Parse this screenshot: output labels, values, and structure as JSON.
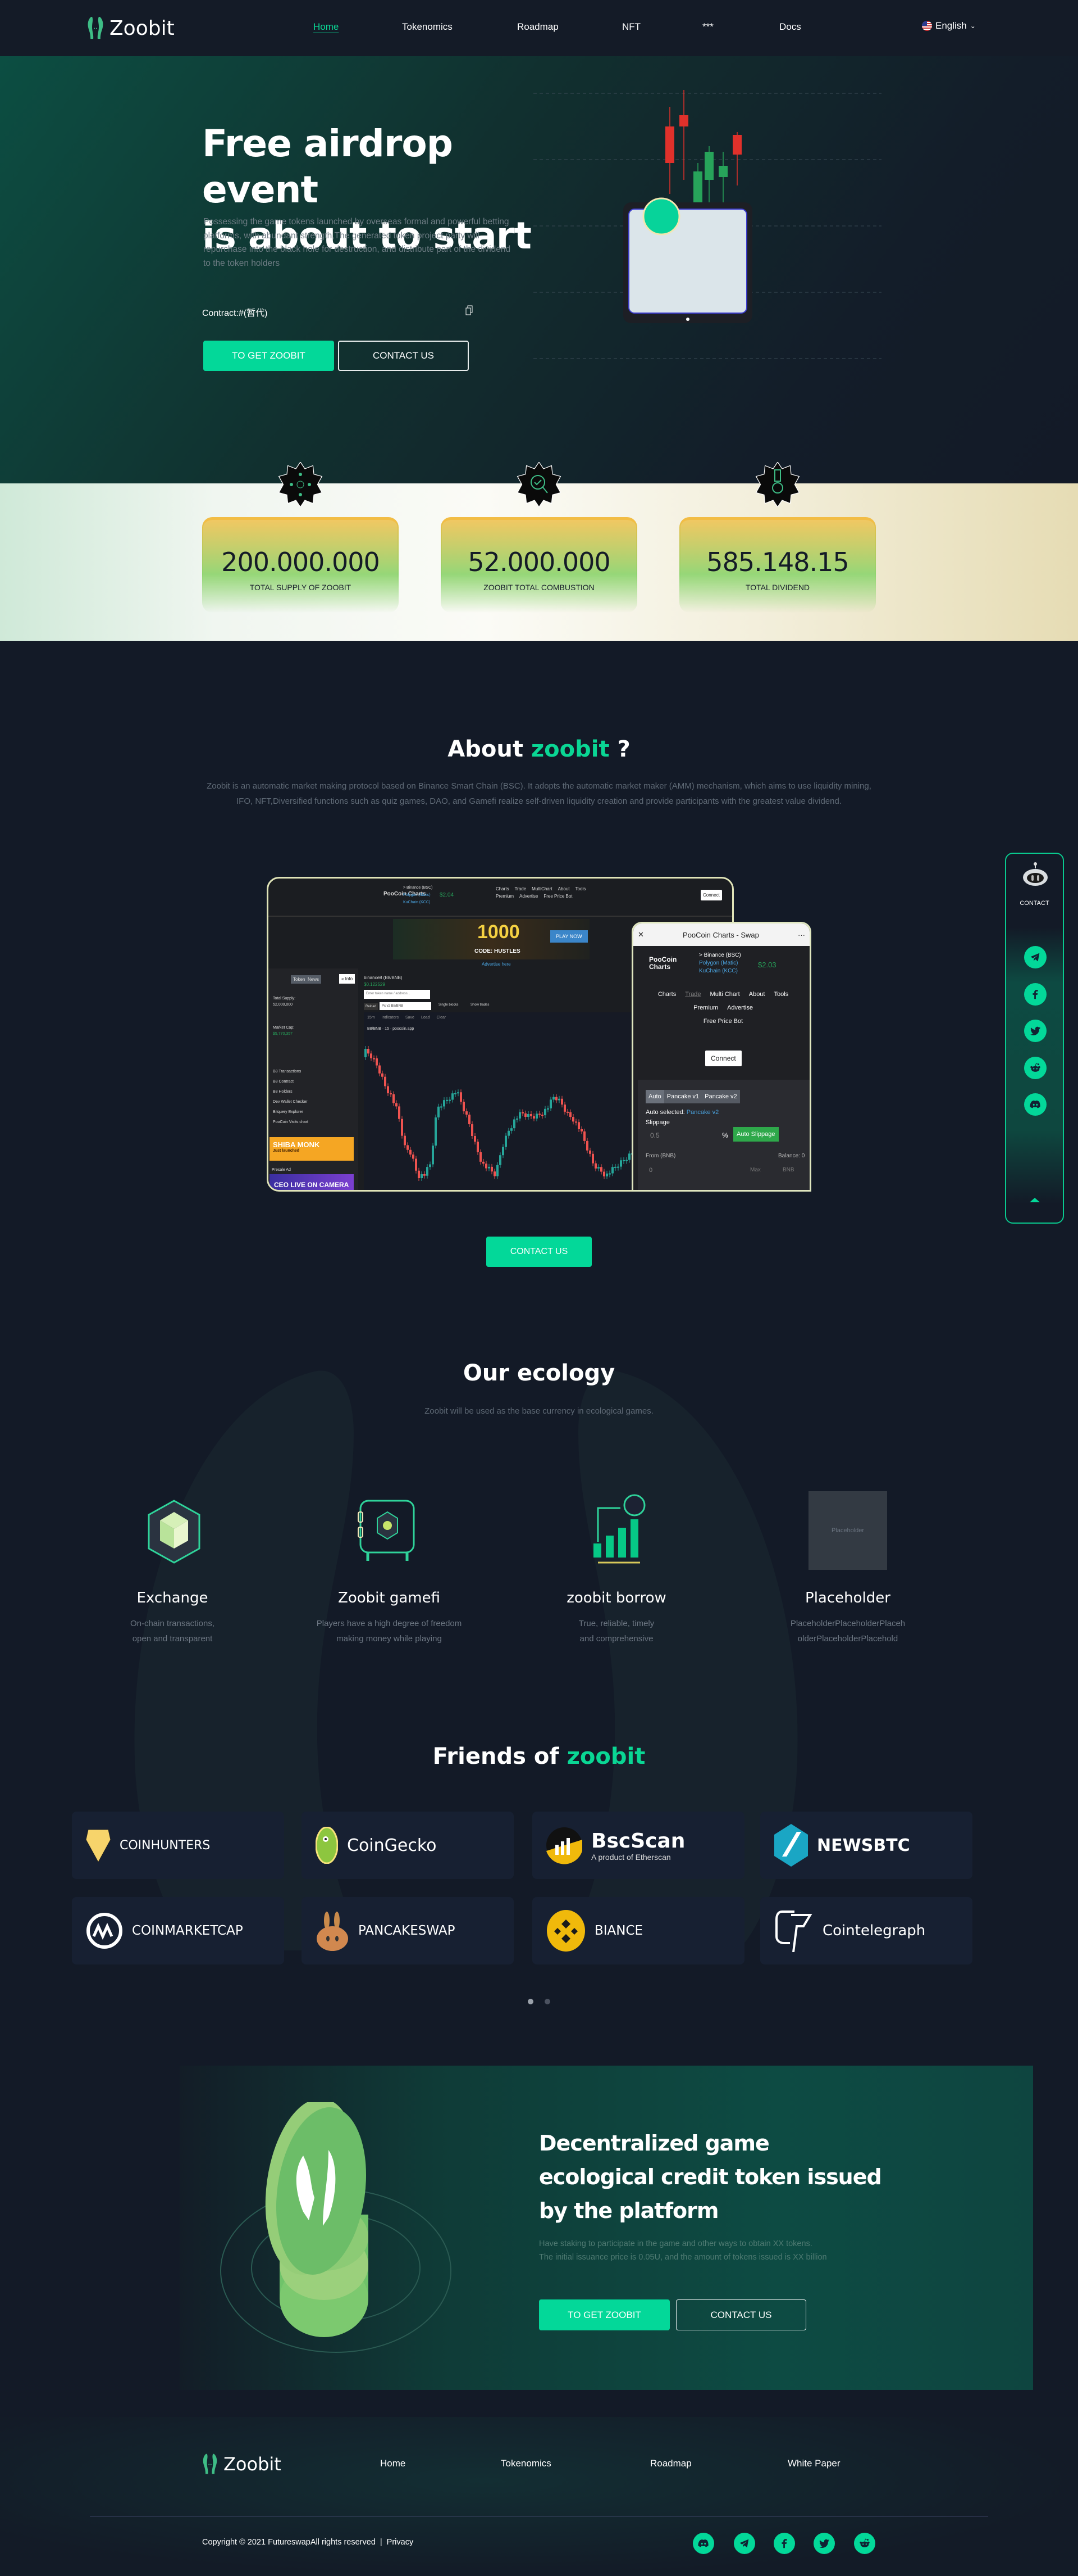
{
  "colors": {
    "accent": "#03d899",
    "bg": "#131a27",
    "card_border": "#f2bd45",
    "candle_up": "#27a35a",
    "candle_down": "#e0312b"
  },
  "nav": {
    "brand": "Zoobit",
    "items": [
      {
        "label": "Home",
        "active": true
      },
      {
        "label": "Tokenomics"
      },
      {
        "label": "Roadmap"
      },
      {
        "label": "NFT"
      },
      {
        "label": "***"
      },
      {
        "label": "Docs"
      }
    ],
    "language": "English",
    "language_icon": "us-flag-icon"
  },
  "hero": {
    "title_line1": "Free airdrop event",
    "title_line2": "is about to start",
    "description": "Possessing the game tokens launched by overseas formal and powerful betting platforms, with abundant strength,The generated token project party will repurchase into the black hole for destruction, and distribute part of the dividend to the token holders",
    "contract": "Contract:#(暂代)",
    "primary_button": "TO GET ZOOBIT",
    "secondary_button": "CONTACT US"
  },
  "stats": [
    {
      "value": "200.000.000",
      "label": "TOTAL SUPPLY OF ZOOBIT",
      "icon": "network-icon"
    },
    {
      "value": "52.000.000",
      "label": "ZOOBIT TOTAL COMBUSTION",
      "icon": "magnifier-check-icon"
    },
    {
      "value": "585.148.15",
      "label": "TOTAL DIVIDEND",
      "icon": "medal-icon"
    }
  ],
  "about": {
    "title_prefix": "About",
    "title_accent": "zoobit",
    "title_suffix": "?",
    "description": "Zoobit is an automatic market making protocol based on Binance Smart Chain (BSC). It adopts the automatic market maker (AMM) mechanism, which aims to use liquidity mining, IFO, NFT,Diversified functions such as quiz games, DAO, and Gamefi realize self-driven liquidity creation and provide participants with the greatest value dividend.",
    "button": "CONTACT US",
    "mockup": {
      "brand": "PooCoin Charts",
      "chains": [
        "> Binance (BSC)",
        "Polygon (Matic)",
        "KuChain (KCC)"
      ],
      "price": "$2.04",
      "menu": [
        "Charts",
        "Trade",
        "MultiChart",
        "About",
        "Tools",
        "Premium",
        "Advertise",
        "Free Price Bot"
      ],
      "connect": "Connect",
      "ad_big": "1000",
      "ad_code": "CODE: HUSTLES",
      "ad_play": "PLAY NOW",
      "advertise": "Advertise here",
      "tabs": [
        "Token",
        "News"
      ],
      "info": "« Info",
      "pair": "binance8 (B8/BNB)",
      "pair_price": "$0.122529",
      "search_placeholder": "Enter token name / address...",
      "reload": "Reload",
      "pair_select": "Pc v2 B8/BNB",
      "single_blocks": "Single blocks",
      "show_trades": "Show trades",
      "toolbar": [
        "15m",
        "Indicators",
        "Save",
        "Load",
        "Clear"
      ],
      "legend": "B8/BNB · 15 · poocoin.app",
      "total_supply_label": "Total Supply:",
      "total_supply": "52,000,000",
      "market_cap_label": "Market Cap:",
      "market_cap": "$5,770,357",
      "links": [
        "B8 Transactions",
        "B8 Contract",
        "B8 Holders",
        "Dev Wallet Checker",
        "Bitquery Explorer",
        "PooCoin Visits chart"
      ],
      "ad1": "SHIBA MONK",
      "ad1_sub": "Just launched",
      "presale": "Presale Ad",
      "ad2": "CEO LIVE ON CAMERA"
    },
    "phone": {
      "title": "PooCoin Charts - Swap",
      "brand": "PooCoin Charts",
      "chains": [
        "> Binance (BSC)",
        "Polygon (Matic)",
        "KuChain (KCC)"
      ],
      "price": "$2.03",
      "menu": [
        "Charts",
        "Trade",
        "Multi Chart",
        "About",
        "Tools",
        "Premium",
        "Advertise",
        "Free Price Bot"
      ],
      "connect": "Connect",
      "routers": [
        "Auto",
        "Pancake v1",
        "Pancake v2"
      ],
      "auto_selected_label": "Auto selected:",
      "auto_selected": "Pancake v2",
      "slippage_label": "Slippage",
      "slippage": "0.5",
      "percent": "%",
      "auto_slippage": "Auto Slippage",
      "from_label": "From (BNB)",
      "balance": "Balance: 0",
      "amount": "0",
      "max": "Max",
      "token": "BNB"
    }
  },
  "sidebar": {
    "label": "CONTACT",
    "icons": [
      "telegram-icon",
      "facebook-icon",
      "twitter-icon",
      "reddit-icon",
      "discord-icon"
    ]
  },
  "ecology": {
    "title": "Our ecology",
    "subtitle": "Zoobit will be used as the base currency in ecological games.",
    "items": [
      {
        "title": "Exchange",
        "desc1": "On-chain transactions,",
        "desc2": "open and transparent"
      },
      {
        "title": "Zoobit gamefi",
        "desc1": "Players have a high degree of freedom",
        "desc2": "making money while playing"
      },
      {
        "title": "zoobit borrow",
        "desc1": "True, reliable, timely",
        "desc2": "and comprehensive"
      },
      {
        "title": "Placeholder",
        "desc1": "PlaceholderPlaceholderPlaceh",
        "desc2": "olderPlaceholderPlacehold",
        "image_text": "Placeholder"
      }
    ]
  },
  "friends": {
    "title_prefix": "Friends of",
    "title_accent": "zoobit",
    "partners": [
      {
        "name": "COINHUNTERS"
      },
      {
        "name": "CoinGecko"
      },
      {
        "name": "BscScan",
        "sub": "A product of Etherscan"
      },
      {
        "name": "NEWSBTC"
      },
      {
        "name": "COINMARKETCAP"
      },
      {
        "name": "PANCAKESWAP"
      },
      {
        "name": "BIANCE"
      },
      {
        "name": "Cointelegraph"
      }
    ],
    "pages": 2,
    "current_page": 1
  },
  "banner": {
    "title_line1": "Decentralized game",
    "title_line2": "ecological credit token issued",
    "title_line3": "by the platform",
    "desc1": "Have staking to participate in the game and other ways to obtain XX tokens.",
    "desc2": "The initial issuance price is 0.05U, and the amount of tokens issued is XX billion",
    "primary_button": "TO GET ZOOBIT",
    "secondary_button": "CONTACT US"
  },
  "footer": {
    "brand": "Zoobit",
    "links": [
      "Home",
      "Tokenomics",
      "Roadmap",
      "White Paper"
    ],
    "copyright": "Copyright © 2021 FutureswapAll rights reserved",
    "privacy": "Privacy",
    "social": [
      "discord-icon",
      "telegram-icon",
      "facebook-icon",
      "twitter-icon",
      "reddit-icon"
    ]
  }
}
